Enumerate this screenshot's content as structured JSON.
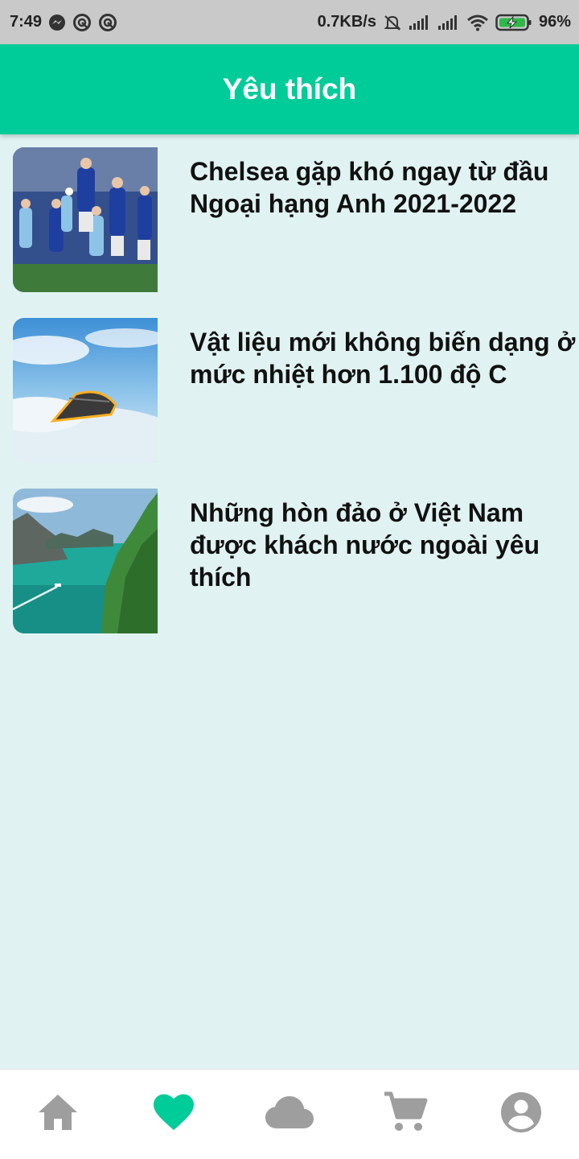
{
  "status_bar": {
    "time": "7:49",
    "net_speed": "0.7KB/s",
    "battery": "96%",
    "left_icons": [
      "messenger-icon",
      "sync-icon",
      "sync-icon"
    ],
    "right_icons": [
      "mute-icon",
      "signal-icon",
      "signal-icon",
      "wifi-icon",
      "battery-charging-icon"
    ]
  },
  "header": {
    "title": "Yêu thích"
  },
  "favorites": [
    {
      "title": "Chelsea gặp khó ngay từ đầu Ngoại hạng Anh 2021-2022",
      "thumbnail": "football-match-photo"
    },
    {
      "title": "Vật liệu mới không biến dạng ở mức nhiệt hơn 1.100 độ C",
      "thumbnail": "hypersonic-aircraft-photo"
    },
    {
      "title": "Những hòn đảo ở Việt Nam được khách nước ngoài yêu thích",
      "thumbnail": "island-bay-photo"
    }
  ],
  "bottom_nav": {
    "items": [
      "home-icon",
      "heart-icon",
      "cloud-icon",
      "cart-icon",
      "account-icon"
    ],
    "active_index": 1
  },
  "colors": {
    "accent": "#00cc99",
    "background": "#e0f3f2",
    "status_bar": "#c9c9c9",
    "nav_inactive": "#9e9e9e"
  }
}
